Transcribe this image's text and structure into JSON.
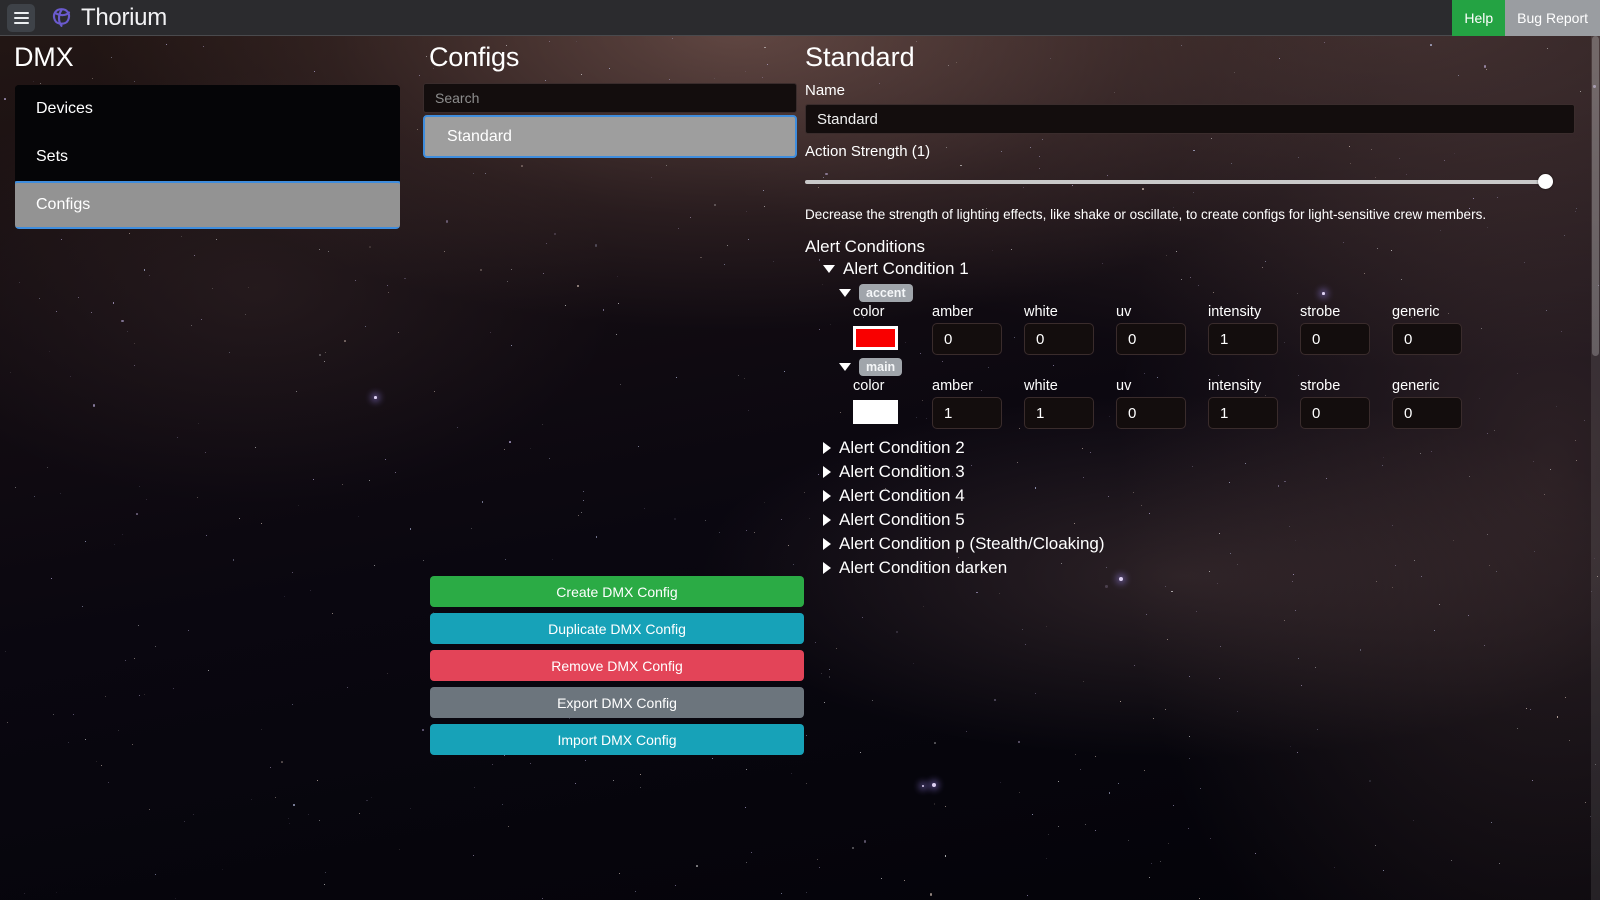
{
  "topbar": {
    "menu_icon": "hamburger-icon",
    "logo_icon": "thorium-trefoil-logo",
    "app_title": "Thorium",
    "help_label": "Help",
    "bug_report_label": "Bug Report",
    "colors": {
      "help_green": "#24a343",
      "bug_gray": "#9a9da1",
      "bar_bg": "#2b2b2e"
    }
  },
  "sidebar": {
    "title": "DMX",
    "items": [
      {
        "label": "Devices",
        "selected": false
      },
      {
        "label": "Sets",
        "selected": false
      },
      {
        "label": "Configs",
        "selected": true
      }
    ],
    "selected_accent": "#3f8ddd"
  },
  "list_panel": {
    "title": "Configs",
    "search": {
      "placeholder": "Search",
      "value": ""
    },
    "items": [
      {
        "label": "Standard",
        "selected": true
      }
    ],
    "buttons": [
      {
        "label": "Create DMX Config",
        "color": "#2bab45",
        "name": "create-dmx-config-button"
      },
      {
        "label": "Duplicate DMX Config",
        "color": "#17a2b8",
        "name": "duplicate-dmx-config-button"
      },
      {
        "label": "Remove DMX Config",
        "color": "#e34458",
        "name": "remove-dmx-config-button"
      },
      {
        "label": "Export DMX Config",
        "color": "#6c757d",
        "name": "export-dmx-config-button"
      },
      {
        "label": "Import DMX Config",
        "color": "#17a2b8",
        "name": "import-dmx-config-button"
      }
    ]
  },
  "detail": {
    "title": "Standard",
    "name_label": "Name",
    "name_value": "Standard",
    "action_strength_label": "Action Strength (1)",
    "action_strength_value": 1,
    "action_strength_min": 0,
    "action_strength_max": 1,
    "action_strength_description": "Decrease the strength of lighting effects, like shake or oscillate, to create configs for light-sensitive crew members.",
    "alert_conditions_label": "Alert Conditions",
    "expanded_condition": {
      "label": "Alert Condition 1",
      "expanded": true,
      "devices": [
        {
          "tag": "accent",
          "expanded": true,
          "channels": [
            {
              "label": "color",
              "type": "color",
              "value": "#f90000"
            },
            {
              "label": "amber",
              "type": "number",
              "value": "0"
            },
            {
              "label": "white",
              "type": "number",
              "value": "0"
            },
            {
              "label": "uv",
              "type": "number",
              "value": "0"
            },
            {
              "label": "intensity",
              "type": "number",
              "value": "1"
            },
            {
              "label": "strobe",
              "type": "number",
              "value": "0"
            },
            {
              "label": "generic",
              "type": "number",
              "value": "0"
            }
          ]
        },
        {
          "tag": "main",
          "expanded": true,
          "channels": [
            {
              "label": "color",
              "type": "color",
              "value": "#ffffff"
            },
            {
              "label": "amber",
              "type": "number",
              "value": "1"
            },
            {
              "label": "white",
              "type": "number",
              "value": "1"
            },
            {
              "label": "uv",
              "type": "number",
              "value": "0"
            },
            {
              "label": "intensity",
              "type": "number",
              "value": "1"
            },
            {
              "label": "strobe",
              "type": "number",
              "value": "0"
            },
            {
              "label": "generic",
              "type": "number",
              "value": "0"
            }
          ]
        }
      ]
    },
    "collapsed_conditions": [
      {
        "label": "Alert Condition 2"
      },
      {
        "label": "Alert Condition 3"
      },
      {
        "label": "Alert Condition 4"
      },
      {
        "label": "Alert Condition 5"
      },
      {
        "label": "Alert Condition p (Stealth/Cloaking)"
      },
      {
        "label": "Alert Condition darken"
      }
    ]
  }
}
